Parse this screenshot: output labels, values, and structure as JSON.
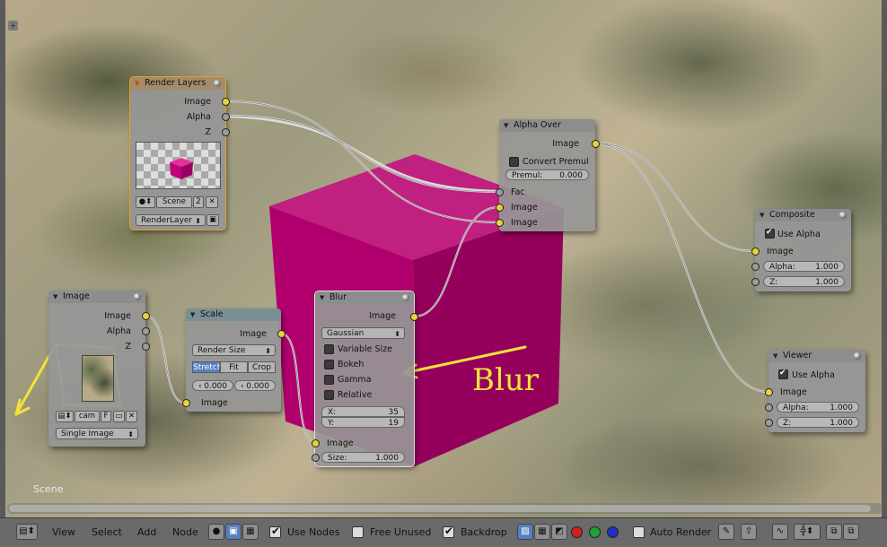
{
  "colors": {
    "socket_image": "#e6d33a",
    "socket_value": "#9c9c9c",
    "cube": "#b1006e",
    "annotation": "#f1e23c",
    "selected": "#5680c2"
  },
  "editor": {
    "scene_label": "Scene"
  },
  "annotation": {
    "text": "Blur"
  },
  "nodes": {
    "render_layers": {
      "title": "Render Layers",
      "outputs": [
        "Image",
        "Alpha",
        "Z"
      ],
      "scene_field": "Scene",
      "scene_users": "2",
      "layer_menu": "RenderLayer"
    },
    "image": {
      "title": "Image",
      "outputs": [
        "Image",
        "Alpha",
        "Z"
      ],
      "image_name": "cam",
      "fake_user": "F",
      "source_menu": "Single Image"
    },
    "scale": {
      "title": "Scale",
      "output": "Image",
      "space_menu": "Render Size",
      "modes": [
        "Stretch",
        "Fit",
        "Crop"
      ],
      "selected_mode": "Stretch",
      "x_value": "0.000",
      "y_value": "0.000",
      "input": "Image"
    },
    "blur": {
      "title": "Blur",
      "output": "Image",
      "filter_menu": "Gaussian",
      "options": [
        "Variable Size",
        "Bokeh",
        "Gamma",
        "Relative"
      ],
      "x_label": "X:",
      "x_value": "35",
      "y_label": "Y:",
      "y_value": "19",
      "input": "Image",
      "size_label": "Size:",
      "size_value": "1.000"
    },
    "alpha_over": {
      "title": "Alpha Over",
      "output": "Image",
      "convert_premul": "Convert Premul",
      "premul_label": "Premul:",
      "premul_value": "0.000",
      "inputs": [
        "Fac",
        "Image",
        "Image"
      ]
    },
    "composite": {
      "title": "Composite",
      "use_alpha": "Use Alpha",
      "input": "Image",
      "alpha_label": "Alpha:",
      "alpha_value": "1.000",
      "z_label": "Z:",
      "z_value": "1.000"
    },
    "viewer": {
      "title": "Viewer",
      "use_alpha": "Use Alpha",
      "input": "Image",
      "alpha_label": "Alpha:",
      "alpha_value": "1.000",
      "z_label": "Z:",
      "z_value": "1.000"
    }
  },
  "header": {
    "menus": [
      "View",
      "Select",
      "Add",
      "Node"
    ],
    "use_nodes": "Use Nodes",
    "free_unused": "Free Unused",
    "backdrop": "Backdrop",
    "auto_render": "Auto Render"
  }
}
